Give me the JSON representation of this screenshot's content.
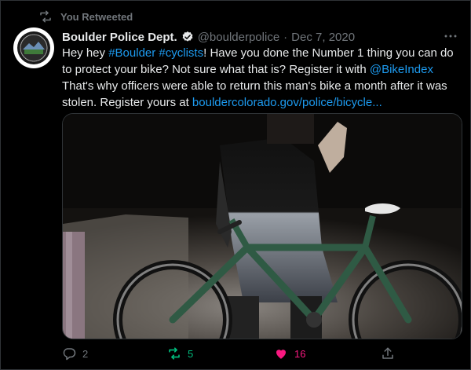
{
  "retweet_banner": {
    "text": "You Retweeted"
  },
  "tweet": {
    "author_name": "Boulder Police Dept.",
    "handle": "@boulderpolice",
    "separator": "·",
    "date": "Dec 7, 2020",
    "text_parts": {
      "p1": "Hey hey ",
      "tag1": "#Boulder",
      "p2": " ",
      "tag2": "#cyclists",
      "p3": "! Have you done the Number 1 thing you can do to protect your bike? Not sure what that is? Register it with ",
      "mention": "@BikeIndex",
      "p4": " That's why officers were able to return this man's bike a month after it was stolen. Register yours at  ",
      "url": "bouldercolorado.gov/police/bicycle..."
    }
  },
  "actions": {
    "reply_count": "2",
    "retweet_count": "5",
    "like_count": "16"
  },
  "colors": {
    "accent": "#1d9bf0",
    "retweet_active": "#00ba7c",
    "like_active": "#f91880",
    "muted": "#71767b"
  },
  "icons": [
    "retweet-icon",
    "verified-badge-icon",
    "more-icon",
    "reply-icon",
    "like-icon",
    "share-icon"
  ]
}
